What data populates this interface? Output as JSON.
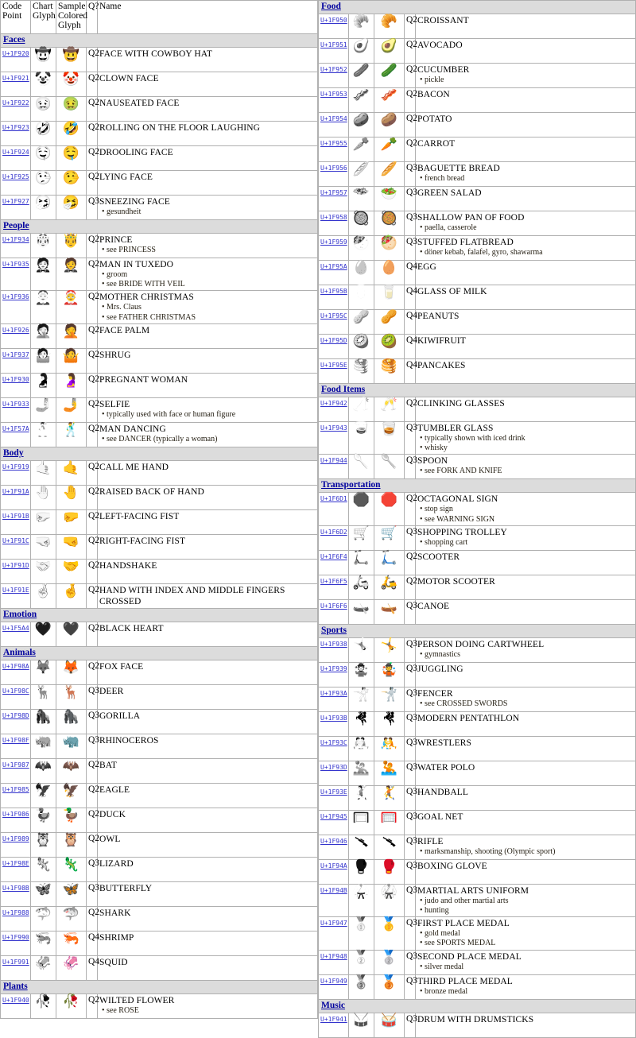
{
  "page": {
    "title": "Unicode Emoji Candidates Chart",
    "link_color": "#3333cc",
    "section_color": "#00009e",
    "section_bg": "#dcdcdc",
    "header_bg": "#e9e9e9",
    "border_color": "#b0b0b0"
  },
  "headers": {
    "code_point": "Code Point",
    "chart_glyph": "Chart Glyph",
    "sample_colored_glyph": "Sample Colored Glyph",
    "q": "Q?",
    "name": "Name"
  },
  "left_column": [
    {
      "type": "section",
      "label": "Faces"
    },
    {
      "type": "row",
      "cp": "U+1F920",
      "chart": "🤠",
      "sample": "🤠",
      "q": "Q2",
      "name": "FACE WITH COWBOY HAT",
      "annotations": []
    },
    {
      "type": "row",
      "cp": "U+1F921",
      "chart": "🤡",
      "sample": "🤡",
      "q": "Q2",
      "name": "CLOWN FACE",
      "annotations": []
    },
    {
      "type": "row",
      "cp": "U+1F922",
      "chart": "🤢",
      "sample": "🤢",
      "q": "Q2",
      "name": "NAUSEATED FACE",
      "annotations": []
    },
    {
      "type": "row",
      "cp": "U+1F923",
      "chart": "🤣",
      "sample": "🤣",
      "q": "Q2",
      "name": "ROLLING ON THE FLOOR LAUGHING",
      "annotations": []
    },
    {
      "type": "row",
      "cp": "U+1F924",
      "chart": "🤤",
      "sample": "🤤",
      "q": "Q2",
      "name": "DROOLING FACE",
      "annotations": []
    },
    {
      "type": "row",
      "cp": "U+1F925",
      "chart": "🤥",
      "sample": "🤥",
      "q": "Q2",
      "name": "LYING FACE",
      "annotations": []
    },
    {
      "type": "row",
      "cp": "U+1F927",
      "chart": "🤧",
      "sample": "🤧",
      "q": "Q3",
      "name": "SNEEZING FACE",
      "annotations": [
        "gesundheit"
      ]
    },
    {
      "type": "section",
      "label": "People"
    },
    {
      "type": "row",
      "cp": "U+1F934",
      "chart": "🤴",
      "sample": "🤴",
      "q": "Q2",
      "name": "PRINCE",
      "annotations": [
        "see PRINCESS"
      ]
    },
    {
      "type": "row",
      "cp": "U+1F935",
      "chart": "🤵",
      "sample": "🤵",
      "q": "Q2",
      "name": "MAN IN TUXEDO",
      "annotations": [
        "groom",
        "see BRIDE WITH VEIL"
      ]
    },
    {
      "type": "row",
      "cp": "U+1F936",
      "chart": "🤶",
      "sample": "🤶",
      "q": "Q2",
      "name": "MOTHER CHRISTMAS",
      "annotations": [
        "Mrs. Claus",
        "see FATHER CHRISTMAS"
      ]
    },
    {
      "type": "row",
      "cp": "U+1F926",
      "chart": "🤦",
      "sample": "🤦",
      "q": "Q2",
      "name": "FACE PALM",
      "annotations": []
    },
    {
      "type": "row",
      "cp": "U+1F937",
      "chart": "🤷",
      "sample": "🤷",
      "q": "Q2",
      "name": "SHRUG",
      "annotations": []
    },
    {
      "type": "row",
      "cp": "U+1F930",
      "chart": "🤰",
      "sample": "🤰",
      "q": "Q2",
      "name": "PREGNANT WOMAN",
      "annotations": []
    },
    {
      "type": "row",
      "cp": "U+1F933",
      "chart": "🤳",
      "sample": "🤳",
      "q": "Q2",
      "name": "SELFIE",
      "annotations": [
        "typically used with face or human figure"
      ]
    },
    {
      "type": "row",
      "cp": "U+1F57A",
      "chart": "🕺",
      "sample": "🕺",
      "q": "Q2",
      "name": "MAN DANCING",
      "annotations": [
        "see DANCER (typically a woman)"
      ]
    },
    {
      "type": "section",
      "label": "Body"
    },
    {
      "type": "row",
      "cp": "U+1F919",
      "chart": "🤙",
      "sample": "🤙",
      "q": "Q2",
      "name": "CALL ME HAND",
      "annotations": []
    },
    {
      "type": "row",
      "cp": "U+1F91A",
      "chart": "🤚",
      "sample": "🤚",
      "q": "Q2",
      "name": "RAISED BACK OF HAND",
      "annotations": []
    },
    {
      "type": "row",
      "cp": "U+1F91B",
      "chart": "🤛",
      "sample": "🤛",
      "q": "Q2",
      "name": "LEFT-FACING FIST",
      "annotations": []
    },
    {
      "type": "row",
      "cp": "U+1F91C",
      "chart": "🤜",
      "sample": "🤜",
      "q": "Q2",
      "name": "RIGHT-FACING FIST",
      "annotations": []
    },
    {
      "type": "row",
      "cp": "U+1F91D",
      "chart": "🤝",
      "sample": "🤝",
      "q": "Q2",
      "name": "HANDSHAKE",
      "annotations": []
    },
    {
      "type": "row",
      "cp": "U+1F91E",
      "chart": "🤞",
      "sample": "🤞",
      "q": "Q2",
      "name": "HAND WITH INDEX AND MIDDLE FINGERS CROSSED",
      "annotations": []
    },
    {
      "type": "section",
      "label": "Emotion"
    },
    {
      "type": "row",
      "cp": "U+1F5A4",
      "chart": "🖤",
      "sample": "🖤",
      "q": "Q2",
      "name": "BLACK HEART",
      "annotations": []
    },
    {
      "type": "section",
      "label": "Animals"
    },
    {
      "type": "row",
      "cp": "U+1F98A",
      "chart": "🦊",
      "sample": "🦊",
      "q": "Q2",
      "name": "FOX FACE",
      "annotations": []
    },
    {
      "type": "row",
      "cp": "U+1F98C",
      "chart": "🦌",
      "sample": "🦌",
      "q": "Q3",
      "name": "DEER",
      "annotations": []
    },
    {
      "type": "row",
      "cp": "U+1F98D",
      "chart": "🦍",
      "sample": "🦍",
      "q": "Q3",
      "name": "GORILLA",
      "annotations": []
    },
    {
      "type": "row",
      "cp": "U+1F98F",
      "chart": "🦏",
      "sample": "🦏",
      "q": "Q3",
      "name": "RHINOCEROS",
      "annotations": []
    },
    {
      "type": "row",
      "cp": "U+1F987",
      "chart": "🦇",
      "sample": "🦇",
      "q": "Q2",
      "name": "BAT",
      "annotations": []
    },
    {
      "type": "row",
      "cp": "U+1F985",
      "chart": "🦅",
      "sample": "🦅",
      "q": "Q2",
      "name": "EAGLE",
      "annotations": []
    },
    {
      "type": "row",
      "cp": "U+1F986",
      "chart": "🦆",
      "sample": "🦆",
      "q": "Q2",
      "name": "DUCK",
      "annotations": []
    },
    {
      "type": "row",
      "cp": "U+1F989",
      "chart": "🦉",
      "sample": "🦉",
      "q": "Q2",
      "name": "OWL",
      "annotations": []
    },
    {
      "type": "row",
      "cp": "U+1F98E",
      "chart": "🦎",
      "sample": "🦎",
      "q": "Q3",
      "name": "LIZARD",
      "annotations": []
    },
    {
      "type": "row",
      "cp": "U+1F98B",
      "chart": "🦋",
      "sample": "🦋",
      "q": "Q3",
      "name": "BUTTERFLY",
      "annotations": []
    },
    {
      "type": "row",
      "cp": "U+1F988",
      "chart": "🦈",
      "sample": "🦈",
      "q": "Q2",
      "name": "SHARK",
      "annotations": []
    },
    {
      "type": "row",
      "cp": "U+1F990",
      "chart": "🦐",
      "sample": "🦐",
      "q": "Q4",
      "name": "SHRIMP",
      "annotations": []
    },
    {
      "type": "row",
      "cp": "U+1F991",
      "chart": "🦑",
      "sample": "🦑",
      "q": "Q4",
      "name": "SQUID",
      "annotations": []
    },
    {
      "type": "section",
      "label": "Plants"
    },
    {
      "type": "row",
      "cp": "U+1F940",
      "chart": "🥀",
      "sample": "🥀",
      "q": "Q2",
      "name": "WILTED FLOWER",
      "annotations": [
        "see ROSE"
      ]
    }
  ],
  "right_column": [
    {
      "type": "section",
      "label": "Food"
    },
    {
      "type": "row",
      "cp": "U+1F950",
      "chart": "🥐",
      "sample": "🥐",
      "q": "Q2",
      "name": "CROISSANT",
      "annotations": []
    },
    {
      "type": "row",
      "cp": "U+1F951",
      "chart": "🥑",
      "sample": "🥑",
      "q": "Q2",
      "name": "AVOCADO",
      "annotations": []
    },
    {
      "type": "row",
      "cp": "U+1F952",
      "chart": "🥒",
      "sample": "🥒",
      "q": "Q2",
      "name": "CUCUMBER",
      "annotations": [
        "pickle"
      ]
    },
    {
      "type": "row",
      "cp": "U+1F953",
      "chart": "🥓",
      "sample": "🥓",
      "q": "Q2",
      "name": "BACON",
      "annotations": []
    },
    {
      "type": "row",
      "cp": "U+1F954",
      "chart": "🥔",
      "sample": "🥔",
      "q": "Q2",
      "name": "POTATO",
      "annotations": []
    },
    {
      "type": "row",
      "cp": "U+1F955",
      "chart": "🥕",
      "sample": "🥕",
      "q": "Q2",
      "name": "CARROT",
      "annotations": []
    },
    {
      "type": "row",
      "cp": "U+1F956",
      "chart": "🥖",
      "sample": "🥖",
      "q": "Q3",
      "name": "BAGUETTE BREAD",
      "annotations": [
        "french bread"
      ]
    },
    {
      "type": "row",
      "cp": "U+1F957",
      "chart": "🥗",
      "sample": "🥗",
      "q": "Q3",
      "name": "GREEN SALAD",
      "annotations": []
    },
    {
      "type": "row",
      "cp": "U+1F958",
      "chart": "🥘",
      "sample": "🥘",
      "q": "Q3",
      "name": "SHALLOW PAN OF FOOD",
      "annotations": [
        "paella, casserole"
      ]
    },
    {
      "type": "row",
      "cp": "U+1F959",
      "chart": "🥙",
      "sample": "🥙",
      "q": "Q3",
      "name": "STUFFED FLATBREAD",
      "annotations": [
        "döner kebab, falafel, gyro, shawarma"
      ]
    },
    {
      "type": "row",
      "cp": "U+1F95A",
      "chart": "🥚",
      "sample": "🥚",
      "q": "Q4",
      "name": "EGG",
      "annotations": []
    },
    {
      "type": "row",
      "cp": "U+1F95B",
      "chart": "🥛",
      "sample": "🥛",
      "q": "Q4",
      "name": "GLASS OF MILK",
      "annotations": []
    },
    {
      "type": "row",
      "cp": "U+1F95C",
      "chart": "🥜",
      "sample": "🥜",
      "q": "Q4",
      "name": "PEANUTS",
      "annotations": []
    },
    {
      "type": "row",
      "cp": "U+1F95D",
      "chart": "🥝",
      "sample": "🥝",
      "q": "Q4",
      "name": "KIWIFRUIT",
      "annotations": []
    },
    {
      "type": "row",
      "cp": "U+1F95E",
      "chart": "🥞",
      "sample": "🥞",
      "q": "Q4",
      "name": "PANCAKES",
      "annotations": []
    },
    {
      "type": "section",
      "label": "Food Items"
    },
    {
      "type": "row",
      "cp": "U+1F942",
      "chart": "🥂",
      "sample": "🥂",
      "q": "Q2",
      "name": "CLINKING GLASSES",
      "annotations": []
    },
    {
      "type": "row",
      "cp": "U+1F943",
      "chart": "🥃",
      "sample": "🥃",
      "q": "Q3",
      "name": "TUMBLER GLASS",
      "annotations": [
        "typically shown with iced drink",
        "whisky"
      ]
    },
    {
      "type": "row",
      "cp": "U+1F944",
      "chart": "🥄",
      "sample": "🥄",
      "q": "Q3",
      "name": "SPOON",
      "annotations": [
        "see FORK AND KNIFE"
      ]
    },
    {
      "type": "section",
      "label": "Transportation"
    },
    {
      "type": "row",
      "cp": "U+1F6D1",
      "chart": "🛑",
      "sample": "🛑",
      "q": "Q2",
      "name": "OCTAGONAL SIGN",
      "annotations": [
        "stop sign",
        "see WARNING SIGN"
      ]
    },
    {
      "type": "row",
      "cp": "U+1F6D2",
      "chart": "🛒",
      "sample": "🛒",
      "q": "Q3",
      "name": "SHOPPING TROLLEY",
      "annotations": [
        "shopping cart"
      ]
    },
    {
      "type": "row",
      "cp": "U+1F6F4",
      "chart": "🛴",
      "sample": "🛴",
      "q": "Q2",
      "name": "SCOOTER",
      "annotations": []
    },
    {
      "type": "row",
      "cp": "U+1F6F5",
      "chart": "🛵",
      "sample": "🛵",
      "q": "Q2",
      "name": "MOTOR SCOOTER",
      "annotations": []
    },
    {
      "type": "row",
      "cp": "U+1F6F6",
      "chart": "🛶",
      "sample": "🛶",
      "q": "Q3",
      "name": "CANOE",
      "annotations": []
    },
    {
      "type": "section",
      "label": "Sports"
    },
    {
      "type": "row",
      "cp": "U+1F938",
      "chart": "🤸",
      "sample": "🤸",
      "q": "Q3",
      "name": "PERSON DOING CARTWHEEL",
      "annotations": [
        "gymnastics"
      ]
    },
    {
      "type": "row",
      "cp": "U+1F939",
      "chart": "🤹",
      "sample": "🤹",
      "q": "Q3",
      "name": "JUGGLING",
      "annotations": []
    },
    {
      "type": "row",
      "cp": "U+1F93A",
      "chart": "🤺",
      "sample": "🤺",
      "q": "Q3",
      "name": "FENCER",
      "annotations": [
        "see CROSSED SWORDS"
      ]
    },
    {
      "type": "row",
      "cp": "U+1F93B",
      "chart": "🤻",
      "sample": "🤻",
      "q": "Q3",
      "name": "MODERN PENTATHLON",
      "annotations": []
    },
    {
      "type": "row",
      "cp": "U+1F93C",
      "chart": "🤼",
      "sample": "🤼",
      "q": "Q3",
      "name": "WRESTLERS",
      "annotations": []
    },
    {
      "type": "row",
      "cp": "U+1F93D",
      "chart": "🤽",
      "sample": "🤽",
      "q": "Q3",
      "name": "WATER POLO",
      "annotations": []
    },
    {
      "type": "row",
      "cp": "U+1F93E",
      "chart": "🤾",
      "sample": "🤾",
      "q": "Q3",
      "name": "HANDBALL",
      "annotations": []
    },
    {
      "type": "row",
      "cp": "U+1F945",
      "chart": "🥅",
      "sample": "🥅",
      "q": "Q3",
      "name": "GOAL NET",
      "annotations": []
    },
    {
      "type": "row",
      "cp": "U+1F946",
      "chart": "🥆",
      "sample": "🥆",
      "q": "Q3",
      "name": "RIFLE",
      "annotations": [
        "marksmanship, shooting (Olympic sport)"
      ]
    },
    {
      "type": "row",
      "cp": "U+1F94A",
      "chart": "🥊",
      "sample": "🥊",
      "q": "Q3",
      "name": "BOXING GLOVE",
      "annotations": []
    },
    {
      "type": "row",
      "cp": "U+1F94B",
      "chart": "🥋",
      "sample": "🥋",
      "q": "Q3",
      "name": "MARTIAL ARTS UNIFORM",
      "annotations": [
        "judo and other martial arts",
        "hunting"
      ]
    },
    {
      "type": "row",
      "cp": "U+1F947",
      "chart": "🥇",
      "sample": "🥇",
      "q": "Q3",
      "name": "FIRST PLACE MEDAL",
      "annotations": [
        "gold medal",
        "see SPORTS MEDAL"
      ]
    },
    {
      "type": "row",
      "cp": "U+1F948",
      "chart": "🥈",
      "sample": "🥈",
      "q": "Q3",
      "name": "SECOND PLACE MEDAL",
      "annotations": [
        "silver medal"
      ]
    },
    {
      "type": "row",
      "cp": "U+1F949",
      "chart": "🥉",
      "sample": "🥉",
      "q": "Q3",
      "name": "THIRD PLACE MEDAL",
      "annotations": [
        "bronze medal"
      ]
    },
    {
      "type": "section",
      "label": "Music"
    },
    {
      "type": "row",
      "cp": "U+1F941",
      "chart": "🥁",
      "sample": "🥁",
      "q": "Q3",
      "name": "DRUM WITH DRUMSTICKS",
      "annotations": []
    }
  ]
}
